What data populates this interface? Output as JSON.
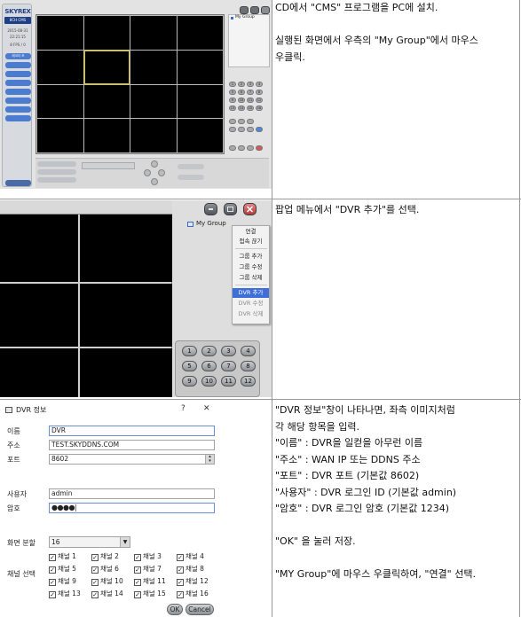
{
  "rows": [
    {
      "lines": [
        "CD에서 \"CMS\" 프로그램을 PC에 설치.",
        "",
        "실행된 화면에서 우측의 \"My Group\"에서 마우스",
        "우클릭."
      ]
    },
    {
      "lines": [
        "팝업 메뉴에서 \"DVR 추가\"를 선택."
      ]
    },
    {
      "lines": [
        "\"DVR 정보\"창이 나타나면, 좌측 이미지처럼",
        "각 해당 항목을 입력.",
        "\"이름\" : DVR을 일컫을 아무런 이름",
        "\"주소\" : WAN IP 또는 DDNS 주소",
        "\"포트\" : DVR 포트 (기본값 8602)",
        "\"사용자\" : DVR 로그인 ID (기본값 admin)",
        "\"암호\" : DVR 로그인 암호 (기본값 1234)",
        "",
        "\"OK\" 을 눌러 저장.",
        "",
        "\"MY Group\"에 마우스 우클릭하여, \"연결\" 선택."
      ]
    }
  ],
  "cms": {
    "logo": "SKYREX",
    "logo_sub": "8CH CMS",
    "date": "2015-08-31",
    "time": "22:21:15",
    "page": "8 FPS / 0",
    "tree_group": "My Group",
    "menu_buttons": [
      "레코더 조",
      "",
      "",
      "",
      "",
      "",
      "",
      "",
      "",
      ""
    ],
    "keypad": [
      "1",
      "2",
      "3",
      "4",
      "5",
      "6",
      "7",
      "8",
      "9",
      "10",
      "11",
      "12",
      "13",
      "14",
      "15",
      "16"
    ]
  },
  "popup": {
    "group": "My Group",
    "items": [
      {
        "label": "연결",
        "state": "normal"
      },
      {
        "label": "접속 끊기",
        "state": "normal"
      },
      {
        "label": "그룹 추가",
        "state": "normal"
      },
      {
        "label": "그룹 수정",
        "state": "normal"
      },
      {
        "label": "그룹 삭제",
        "state": "normal"
      },
      {
        "label": "DVR 추가",
        "state": "highlight"
      },
      {
        "label": "DVR 수정",
        "state": "disabled"
      },
      {
        "label": "DVR 삭제",
        "state": "disabled"
      }
    ],
    "keypad": [
      "1",
      "2",
      "3",
      "4",
      "5",
      "6",
      "7",
      "8",
      "9",
      "10",
      "11",
      "12"
    ]
  },
  "dialog": {
    "title": "DVR 정보",
    "help": "?",
    "close": "✕",
    "labels": {
      "name": "이름",
      "address": "주소",
      "port": "포트",
      "user": "사용자",
      "password": "암호",
      "split": "화면 분할",
      "channel": "채널 선택"
    },
    "values": {
      "name": "DVR",
      "address": "TEST.SKYDDNS.COM",
      "port": "8602",
      "user": "admin",
      "password": "●●●●|",
      "split": "16"
    },
    "channels": [
      "채널 1",
      "채널 2",
      "채널 3",
      "채널 4",
      "채널 5",
      "채널 6",
      "채널 7",
      "채널 8",
      "채널 9",
      "채널 10",
      "채널 11",
      "채널 12",
      "채널 13",
      "채널 14",
      "채널 15",
      "채널 16"
    ],
    "ok": "OK",
    "cancel": "Cancel"
  }
}
